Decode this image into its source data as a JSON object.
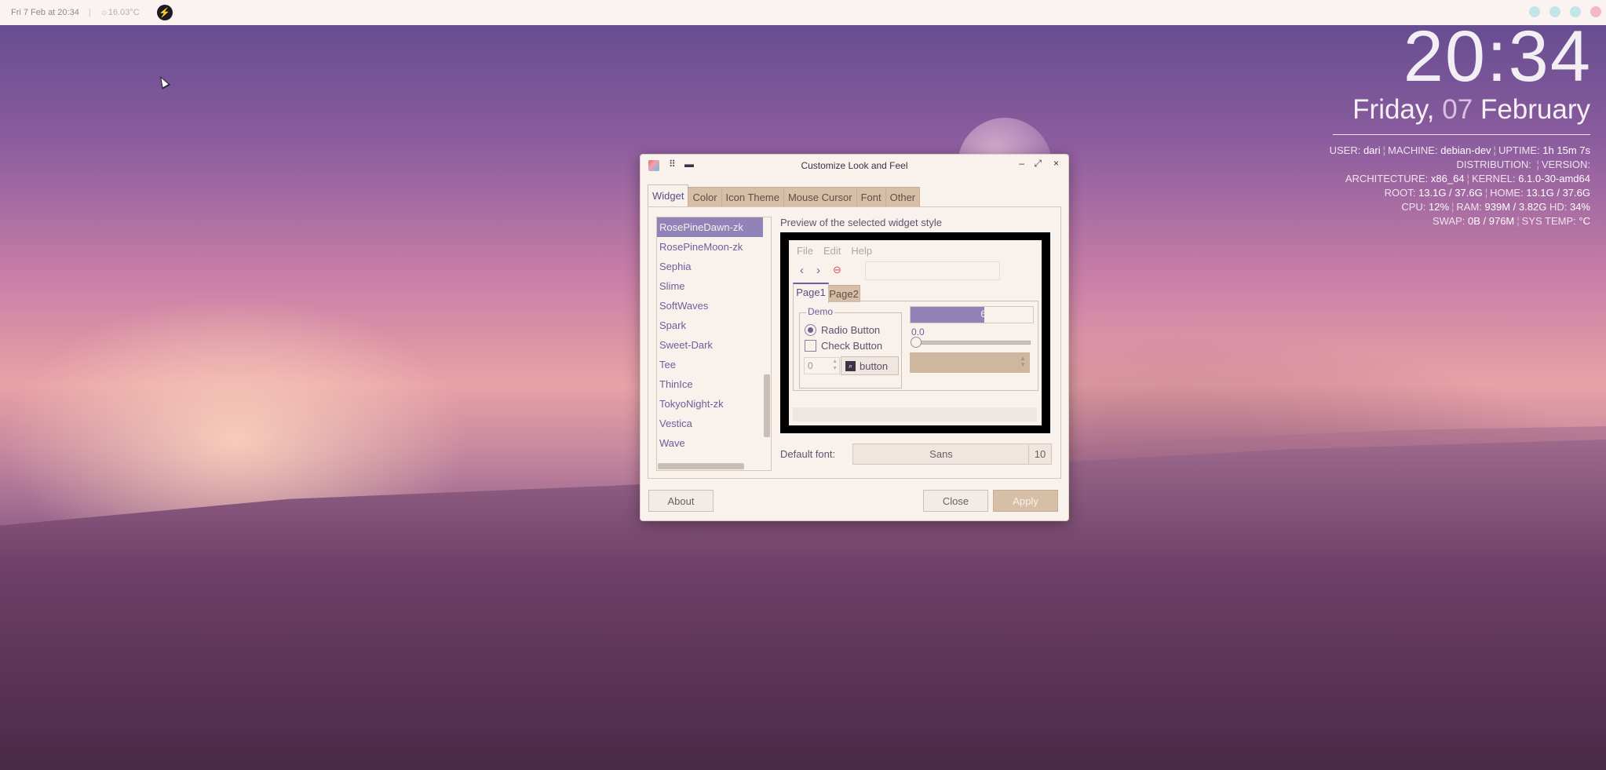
{
  "topbar": {
    "date": "Fri 7 Feb at 20:34",
    "weather": "16.03°C"
  },
  "conky": {
    "time": "20:34",
    "weekday": "Friday,",
    "day": "07",
    "month": "February",
    "user_label": "USER:",
    "user": "dari",
    "machine_label": "MACHINE:",
    "machine": "debian-dev",
    "uptime_label": "UPTIME:",
    "uptime": "1h 15m 7s",
    "distro_label": "DISTRIBUTION:",
    "version_label": "VERSION:",
    "arch_label": "ARCHITECTURE:",
    "arch": "x86_64",
    "kernel_label": "KERNEL:",
    "kernel": "6.1.0-30-amd64",
    "root_label": "ROOT:",
    "root": "13.1G / 37.6G",
    "home_label": "HOME:",
    "home": "13.1G / 37.6G",
    "cpu_label": "CPU:",
    "cpu": "12%",
    "ram_label": "RAM:",
    "ram": "939M / 3.82G",
    "hd_label": "HD:",
    "hd": "34%",
    "swap_label": "SWAP:",
    "swap": "0B / 976M",
    "systemp_label": "SYS TEMP:",
    "systemp": "°C"
  },
  "dialog": {
    "title": "Customize Look and Feel",
    "tabs": [
      "Widget",
      "Color",
      "Icon Theme",
      "Mouse Cursor",
      "Font",
      "Other"
    ],
    "themes": [
      "RosePineDawn-zk",
      "RosePineMoon-zk",
      "Sephia",
      "Slime",
      "SoftWaves",
      "Spark",
      "Sweet-Dark",
      "Tee",
      "ThinIce",
      "TokyoNight-zk",
      "Vestica",
      "Wave"
    ],
    "selected_theme": "RosePineDawn-zk",
    "preview_label": "Preview of the selected widget style",
    "preview": {
      "menu": [
        "File",
        "Edit",
        "Help"
      ],
      "tab1": "Page1",
      "tab2": "Page2",
      "frame_label": "Demo",
      "radio_label": "Radio Button",
      "check_label": "Check Button",
      "spin_value": "0",
      "button_label": "button",
      "progress": 0.6,
      "progress_text": "60 %",
      "scale_value": "0.0"
    },
    "font_label": "Default font:",
    "font_name": "Sans",
    "font_size": "10",
    "about": "About",
    "close": "Close",
    "apply": "Apply"
  },
  "colors": {
    "accent": "#9083b7",
    "tab_inactive": "#d7bea6",
    "dialog_bg": "#f8f1ec",
    "dot1": "#bfe3ea",
    "dot2": "#bfe3ea",
    "dot3": "#bfe3ea",
    "dot4": "#f0b9c5"
  }
}
